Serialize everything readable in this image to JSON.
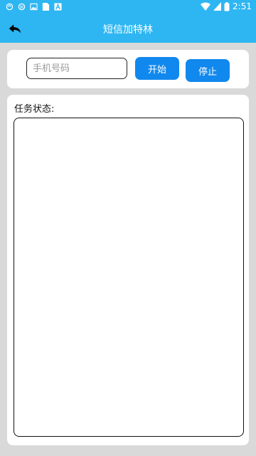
{
  "status_bar": {
    "time": "2:51",
    "icons": [
      "notification-icon-1",
      "notification-icon-2",
      "image-icon",
      "sim-icon",
      "font-icon",
      "wifi-icon",
      "battery-icon"
    ]
  },
  "app_bar": {
    "title": "短信加特林",
    "back_icon": "back-arrow-icon"
  },
  "form": {
    "phone_placeholder": "手机号码",
    "phone_value": "",
    "start_label": "开始",
    "stop_label": "停止"
  },
  "status": {
    "label": "任务状态:",
    "log": ""
  },
  "colors": {
    "primary": "#2eb6f2",
    "button": "#1188ee",
    "background": "#d9d9d9"
  }
}
